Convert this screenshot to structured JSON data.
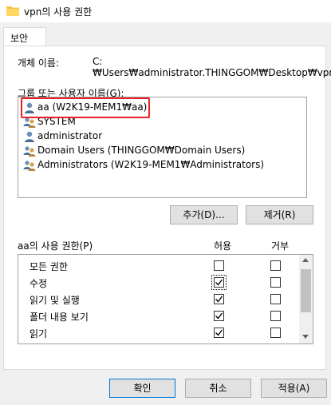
{
  "window": {
    "title": "vpn의 사용 권한",
    "title_icon": "folder-icon"
  },
  "tab": {
    "label": "보안"
  },
  "object": {
    "label": "개체 이름:",
    "value": "C:₩Users₩administrator.THINGGOM₩Desktop₩vpn"
  },
  "groups": {
    "label": "그룹 또는 사용자 이름(G):",
    "items": [
      {
        "name": "aa (W2K19-MEM1₩aa)",
        "icon": "user-icon",
        "selected": true
      },
      {
        "name": "SYSTEM",
        "icon": "group-icon"
      },
      {
        "name": "administrator",
        "icon": "user-icon"
      },
      {
        "name": "Domain Users (THINGGOM₩Domain Users)",
        "icon": "group-icon"
      },
      {
        "name": "Administrators (W2K19-MEM1₩Administrators)",
        "icon": "group-icon"
      }
    ],
    "add_label": "추가(D)...",
    "remove_label": "제거(R)"
  },
  "permissions": {
    "title": "aa의 사용 권한(P)",
    "allow_header": "허용",
    "deny_header": "거부",
    "rows": [
      {
        "name": "모든 권한",
        "allow": false,
        "deny": false
      },
      {
        "name": "수정",
        "allow": true,
        "deny": false
      },
      {
        "name": "읽기 및 실행",
        "allow": true,
        "deny": false
      },
      {
        "name": "폴더 내용 보기",
        "allow": true,
        "deny": false
      },
      {
        "name": "읽기",
        "allow": true,
        "deny": false
      }
    ]
  },
  "footer": {
    "ok_label": "확인",
    "cancel_label": "취소",
    "apply_label": "적용(A)"
  },
  "colors": {
    "highlight_border": "#e8202a",
    "accent": "#0078d7"
  }
}
